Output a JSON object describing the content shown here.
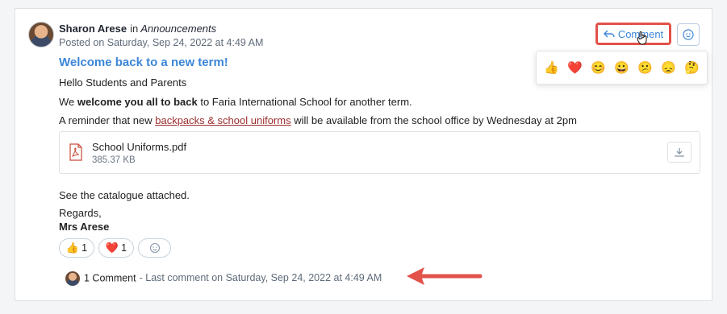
{
  "post": {
    "author": "Sharon Arese",
    "in_word": "in",
    "group": "Announcements",
    "posted": "Posted on Saturday, Sep 24, 2022 at 4:49 AM",
    "title": "Welcome back to a new term!",
    "greeting": "Hello Students and Parents",
    "line2_a": "We ",
    "line2_bold": "welcome you all to back",
    "line2_b": " to Faria International School for another term.",
    "line3_a": "A reminder that new ",
    "line3_link": "backpacks & school uniforms",
    "line3_b": " will be available from the school office by Wednesday at 2pm",
    "catalogue": "See the catalogue attached.",
    "regards": "Regards,",
    "signature": "Mrs Arese"
  },
  "attachment": {
    "name": "School Uniforms.pdf",
    "size": "385.37 KB",
    "icon": "pdf-icon",
    "download_icon": "download-icon"
  },
  "actions": {
    "comment_label": "Comment",
    "comment_icon": "reply-arrow-icon",
    "react_icon": "add-reaction-icon"
  },
  "emoji_picker": [
    "👍",
    "❤️",
    "😊",
    "😀",
    "😕",
    "😞",
    "🤔"
  ],
  "reactions": [
    {
      "emoji": "👍",
      "count": "1"
    },
    {
      "emoji": "❤️",
      "count": "1"
    }
  ],
  "comments": {
    "count_label": "1 Comment",
    "last": "- Last comment on Saturday, Sep 24, 2022 at 4:49 AM"
  },
  "colors": {
    "accent_blue": "#3b86d8",
    "highlight_red": "#e2524a"
  }
}
